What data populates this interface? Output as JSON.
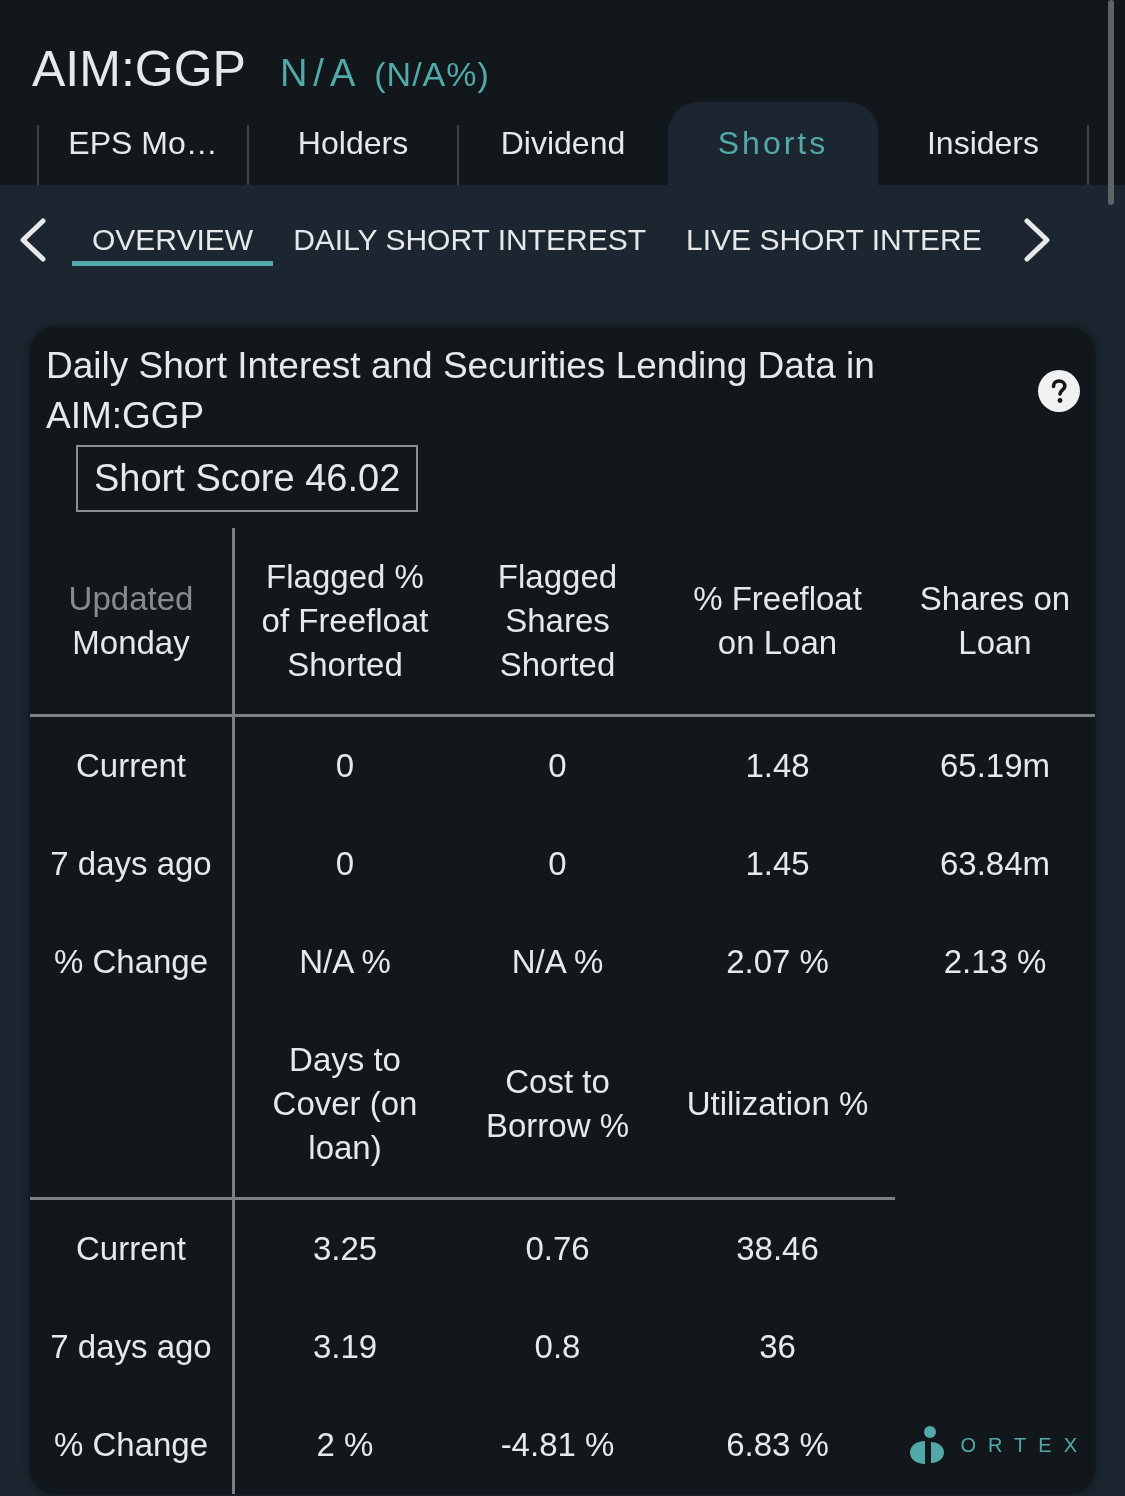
{
  "header": {
    "ticker": "AIM:GGP",
    "price": "N/A",
    "change": "(N/A%)"
  },
  "tabs": [
    {
      "label": "EPS Mo…",
      "selected": false
    },
    {
      "label": "Holders",
      "selected": false
    },
    {
      "label": "Dividend",
      "selected": false
    },
    {
      "label": "Shorts",
      "selected": true
    },
    {
      "label": "Insiders",
      "selected": false
    }
  ],
  "subtabs": [
    {
      "label": "OVERVIEW",
      "selected": true
    },
    {
      "label": "DAILY SHORT INTEREST",
      "selected": false
    },
    {
      "label": "LIVE SHORT INTERE",
      "selected": false
    }
  ],
  "card": {
    "title": "Daily Short Interest and Securities Lending Data in AIM:GGP",
    "short_score": "Short Score 46.02",
    "tables": [
      {
        "updated_label": "Updated",
        "updated_value": "Monday",
        "columns": [
          "Flagged % of Freefloat Shorted",
          "Flagged Shares Shorted",
          "% Freefloat on Loan",
          "Shares on Loan"
        ],
        "rows": [
          {
            "label": "Current",
            "values": [
              "0",
              "0",
              "1.48",
              "65.19m"
            ]
          },
          {
            "label": "7 days ago",
            "values": [
              "0",
              "0",
              "1.45",
              "63.84m"
            ]
          },
          {
            "label": "% Change",
            "values": [
              "N/A %",
              "N/A %",
              "2.07 %",
              "2.13 %"
            ]
          }
        ]
      },
      {
        "columns": [
          "Days to Cover (on loan)",
          "Cost to Borrow %",
          "Utilization %"
        ],
        "rows": [
          {
            "label": "Current",
            "values": [
              "3.25",
              "0.76",
              "38.46"
            ]
          },
          {
            "label": "7 days ago",
            "values": [
              "3.19",
              "0.8",
              "36"
            ]
          },
          {
            "label": "% Change",
            "values": [
              "2 %",
              "-4.81 %",
              "6.83 %"
            ]
          }
        ]
      }
    ],
    "brand": "ORTEX"
  }
}
